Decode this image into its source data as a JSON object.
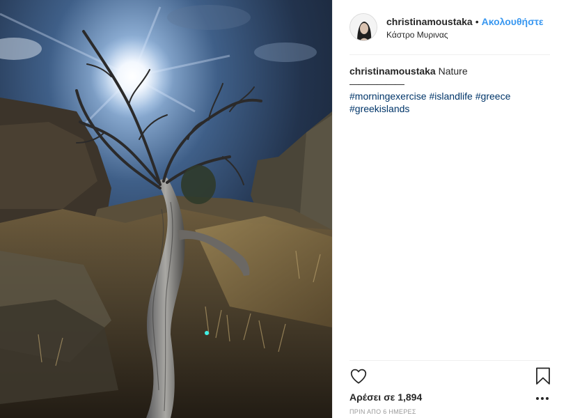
{
  "post": {
    "username": "christinamoustaka",
    "separator": "•",
    "follow_label": "Ακολουθήστε",
    "location": "Κάστρο Μυρινας",
    "caption": {
      "username": "christinamoustaka",
      "text": "Nature",
      "separator_line": "——————",
      "hashtags": [
        "#morningexercise",
        "#islandlife",
        "#greece",
        "#greekislands"
      ]
    },
    "likes_text": "Αρέσει σε 1,894",
    "timestamp": "ΠΡΙΝ ΑΠΟ 6 ΗΜΕΡΕΣ"
  },
  "icons": {
    "like": "heart-outline-icon",
    "save": "bookmark-outline-icon",
    "options": "more-options-icon"
  },
  "colors": {
    "follow": "#3897f0",
    "hashtag": "#003569",
    "text": "#262626",
    "muted": "#999999"
  }
}
